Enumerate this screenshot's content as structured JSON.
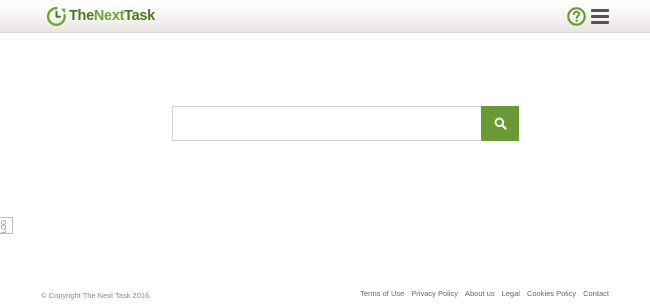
{
  "header": {
    "logo": {
      "text_bold": "The",
      "text_light": "Next",
      "text_end": "Task",
      "icon": "clock-arrow-icon"
    },
    "help_icon": "question-circle-icon",
    "menu_icon": "hamburger-menu-icon"
  },
  "search": {
    "value": "",
    "placeholder": "",
    "button_icon": "search-icon"
  },
  "side_tab": {
    "label": "LOG"
  },
  "footer": {
    "copyright": "© Copyright The Next Task 2016",
    "links": [
      "Terms of Use",
      "Privacy Policy",
      "About us",
      "Legal",
      "Cookies Policy",
      "Contact"
    ]
  },
  "colors": {
    "brand_green": "#6a9a36",
    "brand_dark_green": "#4a7a1d",
    "menu_gray": "#555555"
  }
}
